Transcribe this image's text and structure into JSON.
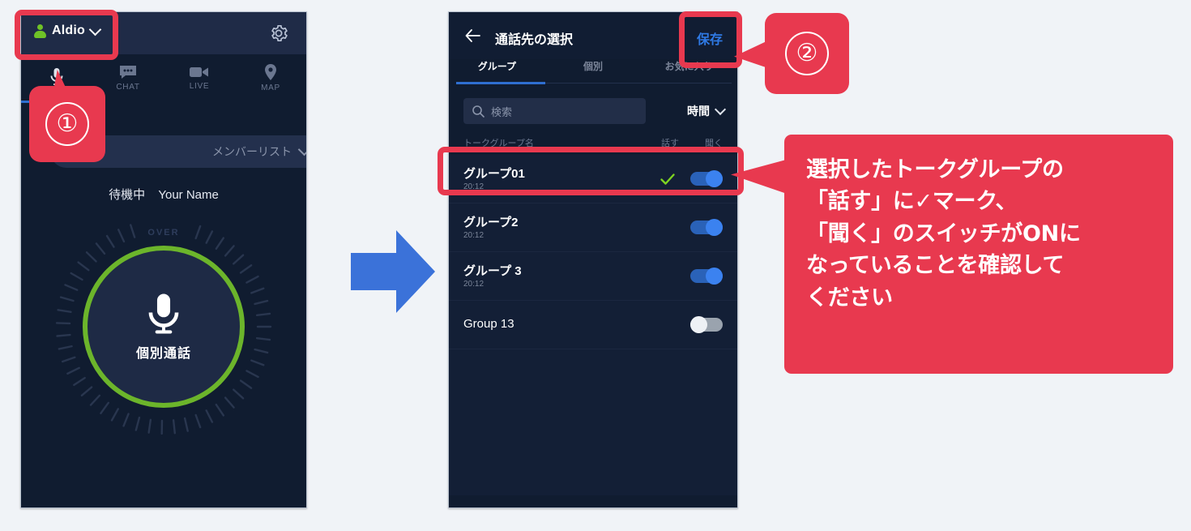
{
  "left_phone": {
    "account": {
      "name": "Aldio",
      "icon": "person-icon",
      "chevron": "chevron-down-icon"
    },
    "settings_icon": "gear-icon",
    "tabs": [
      {
        "label": "",
        "icon": "microphone-icon",
        "active": true
      },
      {
        "label": "CHAT",
        "icon": "chat-icon",
        "active": false
      },
      {
        "label": "LIVE",
        "icon": "video-camera-icon",
        "active": false
      },
      {
        "label": "MAP",
        "icon": "map-pin-icon",
        "active": false
      }
    ],
    "member_list": {
      "label": "メンバーリスト",
      "chevron": "chevron-down-icon"
    },
    "status": {
      "state": "待機中",
      "user": "Your Name"
    },
    "dial": {
      "over_label": "OVER",
      "button_label": "個別通話",
      "mic_icon": "microphone-icon"
    }
  },
  "right_phone": {
    "header": {
      "back_icon": "back-arrow-icon",
      "title": "通話先の選択",
      "save_label": "保存"
    },
    "tabs": [
      {
        "label": "グループ",
        "active": true
      },
      {
        "label": "個別",
        "active": false
      },
      {
        "label": "お気に入り",
        "active": false
      }
    ],
    "search": {
      "placeholder": "検索",
      "value": "",
      "icon": "search-icon"
    },
    "sort": {
      "label": "時間",
      "chevron": "chevron-down-icon"
    },
    "column_headers": {
      "name": "トークグループ名",
      "talk": "話す",
      "listen": "聞く"
    },
    "rows": [
      {
        "name": "グループ01",
        "time": "20:12",
        "checked": true,
        "toggle_on": true
      },
      {
        "name": "グループ2",
        "time": "20:12",
        "checked": false,
        "toggle_on": true
      },
      {
        "name": "グループ 3",
        "time": "20:12",
        "checked": false,
        "toggle_on": true
      },
      {
        "name": "Group 13",
        "time": "",
        "checked": false,
        "toggle_on": false
      }
    ]
  },
  "annotations": {
    "step1": "①",
    "step2": "②",
    "note": "選択したトークグループの\n「話す」に✓マーク、\n「聞く」のスイッチがONに\nなっていることを確認して\nください",
    "arrow_icon": "right-arrow-icon"
  },
  "colors": {
    "background": "#f0f3f7",
    "phone_body": "#101c30",
    "accent_red": "#e8394f",
    "accent_blue": "#2f6fd0",
    "save_blue": "#2f7ae5",
    "green": "#6cb52b",
    "arrow_blue": "#3b72d9"
  }
}
